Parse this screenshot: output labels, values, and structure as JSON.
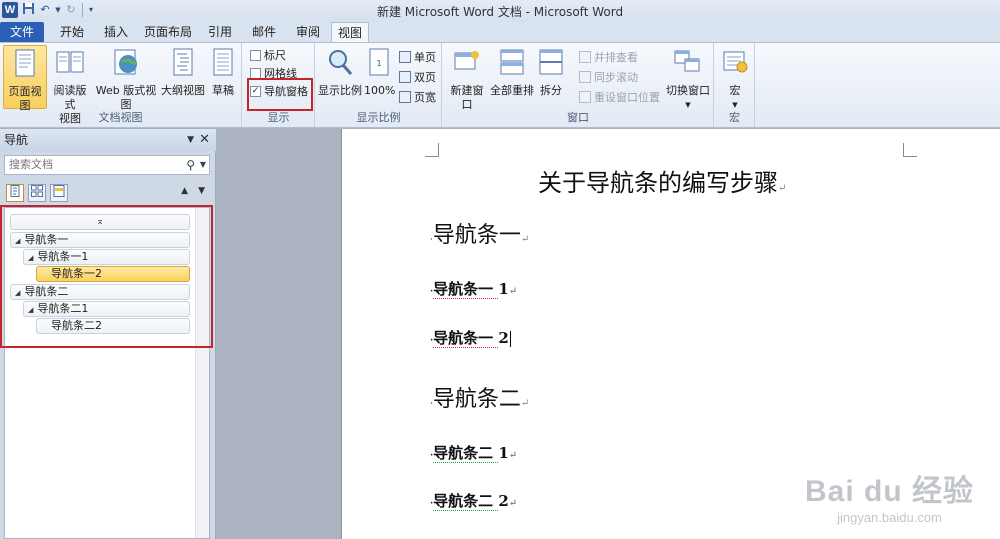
{
  "window": {
    "title": "新建 Microsoft Word 文档 - Microsoft Word",
    "qat": {
      "logo": "W",
      "save_icon": "save-icon",
      "undo_icon": "undo-icon",
      "redo_icon": "redo-icon"
    }
  },
  "tabs": [
    "文件",
    "开始",
    "插入",
    "页面布局",
    "引用",
    "邮件",
    "审阅",
    "视图"
  ],
  "active_tab": "视图",
  "ribbon": {
    "doc_views": {
      "label": "文档视图",
      "buttons": [
        "页面视图",
        "阅读版式\n视图",
        "Web 版式视图",
        "大纲视图",
        "草稿"
      ]
    },
    "show": {
      "label": "显示",
      "ruler": "标尺",
      "gridlines": "网格线",
      "nav_pane": "导航窗格",
      "ruler_checked": false,
      "gridlines_checked": false,
      "nav_pane_checked": true
    },
    "zoom": {
      "label": "显示比例",
      "zoom_btn": "显示比例",
      "hundred_btn": "100%",
      "single": "单页",
      "double": "双页",
      "page_width": "页宽"
    },
    "window": {
      "label": "窗口",
      "new_window": "新建窗口",
      "arrange_all": "全部重排",
      "split": "拆分",
      "side_by_side": "并排查看",
      "sync_scroll": "同步滚动",
      "reset_pos": "重设窗口位置",
      "switch_windows": "切换窗口"
    },
    "macros": {
      "label": "宏",
      "btn": "宏"
    }
  },
  "nav_pane": {
    "title": "导航",
    "search_placeholder": "搜索文档",
    "items": [
      {
        "text": "导航条一",
        "level": 1
      },
      {
        "text": "导航条一1",
        "level": 2
      },
      {
        "text": "导航条一2",
        "level": 3,
        "selected": true
      },
      {
        "text": "导航条二",
        "level": 1
      },
      {
        "text": "导航条二1",
        "level": 2
      },
      {
        "text": "导航条二2",
        "level": 3
      }
    ]
  },
  "document": {
    "title": "关于导航条的编写步骤",
    "h1_1": "导航条一",
    "h2_1": "导航条一 ",
    "h2_1_num": "1",
    "h2_2": "导航条一 ",
    "h2_2_num": "2",
    "h1_2": "导航条二",
    "h2_3": "导航条二 ",
    "h2_3_num": "1",
    "h2_4": "导航条二 ",
    "h2_4_num": "2"
  },
  "watermark": {
    "line1": "Bai du 经验",
    "line2": "jingyan.baidu.com"
  },
  "colors": {
    "accent": "#2b5fb3",
    "highlight": "#f9d15d",
    "annotation": "#c8232c"
  }
}
